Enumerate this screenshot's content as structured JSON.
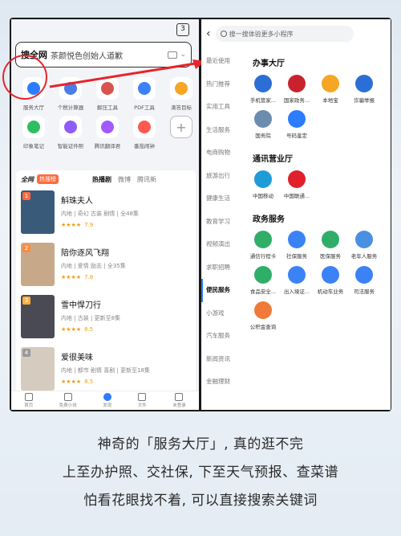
{
  "left": {
    "tab_count": "3",
    "search_brand": "搜全网",
    "search_query": "茶颜悦色创始人道歉",
    "apps": [
      {
        "label": "服务大厅",
        "icon": "link-icon",
        "color": "#2b7cff"
      },
      {
        "label": "个税计算器",
        "icon": "calculator-icon",
        "color": "#4a7de8"
      },
      {
        "label": "解压工具",
        "icon": "zip-icon",
        "color": "#d9534f"
      },
      {
        "label": "PDF工具",
        "icon": "pdf-icon",
        "color": "#3b82f6"
      },
      {
        "label": "滴答目标",
        "icon": "target-icon",
        "color": "#f5a623"
      },
      {
        "label": "印象笔记",
        "icon": "elephant-icon",
        "color": "#2dbe60"
      },
      {
        "label": "智能证件照",
        "icon": "id-photo-icon",
        "color": "#8e5cf7"
      },
      {
        "label": "腾讯翻译君",
        "icon": "translate-icon",
        "color": "#a259ff"
      },
      {
        "label": "番茄闹钟",
        "icon": "tomato-clock-icon",
        "color": "#ff5a4e"
      },
      {
        "label": "",
        "icon": "add-icon",
        "color": "#999999"
      }
    ],
    "hot_tabs": [
      "全网",
      "热搜榜",
      "热播剧",
      "微博",
      "腾讯新"
    ],
    "dramas": [
      {
        "rank": "1",
        "title": "斛珠夫人",
        "meta": "内地 | 奇幻 古装 剧情 | 全48集",
        "stars": "★★★★",
        "score": "7.9",
        "poster": "#3a5a7a",
        "rank_color": "#ff6a3d"
      },
      {
        "rank": "2",
        "title": "陪你逐风飞翔",
        "meta": "内地 | 爱情 励志 | 全35集",
        "stars": "★★★★",
        "score": "7.8",
        "poster": "#c7a98a",
        "rank_color": "#ff8a3d"
      },
      {
        "rank": "3",
        "title": "雪中悍刀行",
        "meta": "内地 | 古装 | 更新至8集",
        "stars": "★★★★",
        "score": "8.5",
        "poster": "#4a4a55",
        "rank_color": "#ffb03d"
      },
      {
        "rank": "4",
        "title": "爱很美味",
        "meta": "内地 | 都市 剧情 喜剧 | 更新至18集",
        "stars": "★★★★",
        "score": "8.5",
        "poster": "#d6cbbf",
        "rank_color": "#999999"
      }
    ],
    "bottom_nav": [
      "首页",
      "免费小说",
      "发现",
      "文件",
      "未登录"
    ]
  },
  "right": {
    "search_placeholder": "搜一搜体验更多小程序",
    "categories": [
      "最近使用",
      "热门推荐",
      "实用工具",
      "生活服务",
      "电商购物",
      "旅游出行",
      "健康生活",
      "教育学习",
      "视频演出",
      "求职招聘",
      "便民服务",
      "小游戏",
      "汽车服务",
      "新闻资讯",
      "金融理财"
    ],
    "active_category": "便民服务",
    "sections": [
      {
        "title": "办事大厅",
        "items": [
          {
            "label": "手机管家...",
            "color": "#2b6fd6"
          },
          {
            "label": "国家政务...",
            "color": "#c8232c"
          },
          {
            "label": "本地宝",
            "color": "#f5a623"
          },
          {
            "label": "诈骗举报",
            "color": "#2b6fd6"
          },
          {
            "label": "国务院",
            "color": "#6b8cae"
          },
          {
            "label": "号码鉴定",
            "color": "#2b7cff"
          }
        ]
      },
      {
        "title": "通讯营业厅",
        "items": [
          {
            "label": "中国移动",
            "color": "#1f9bd8"
          },
          {
            "label": "中国联通...",
            "color": "#e0202b"
          }
        ]
      },
      {
        "title": "政务服务",
        "items": [
          {
            "label": "通信行程卡",
            "color": "#2fae6a"
          },
          {
            "label": "社保服务",
            "color": "#3b82f6"
          },
          {
            "label": "医保服务",
            "color": "#2fae6a"
          },
          {
            "label": "老年人服务",
            "color": "#4a90e2"
          },
          {
            "label": "食品安全...",
            "color": "#2fae6a"
          },
          {
            "label": "出入境证...",
            "color": "#3b82f6"
          },
          {
            "label": "机动车业务",
            "color": "#3b82f6"
          },
          {
            "label": "司法服务",
            "color": "#3b82f6"
          },
          {
            "label": "公积金查询",
            "color": "#f07a3a"
          }
        ]
      }
    ]
  },
  "caption": {
    "line1": "神奇的「服务大厅」, 真的逛不完",
    "line2": "上至办护照、交社保, 下至天气预报、查菜谱",
    "line3": "怕看花眼找不着, 可以直接搜索关键词"
  }
}
